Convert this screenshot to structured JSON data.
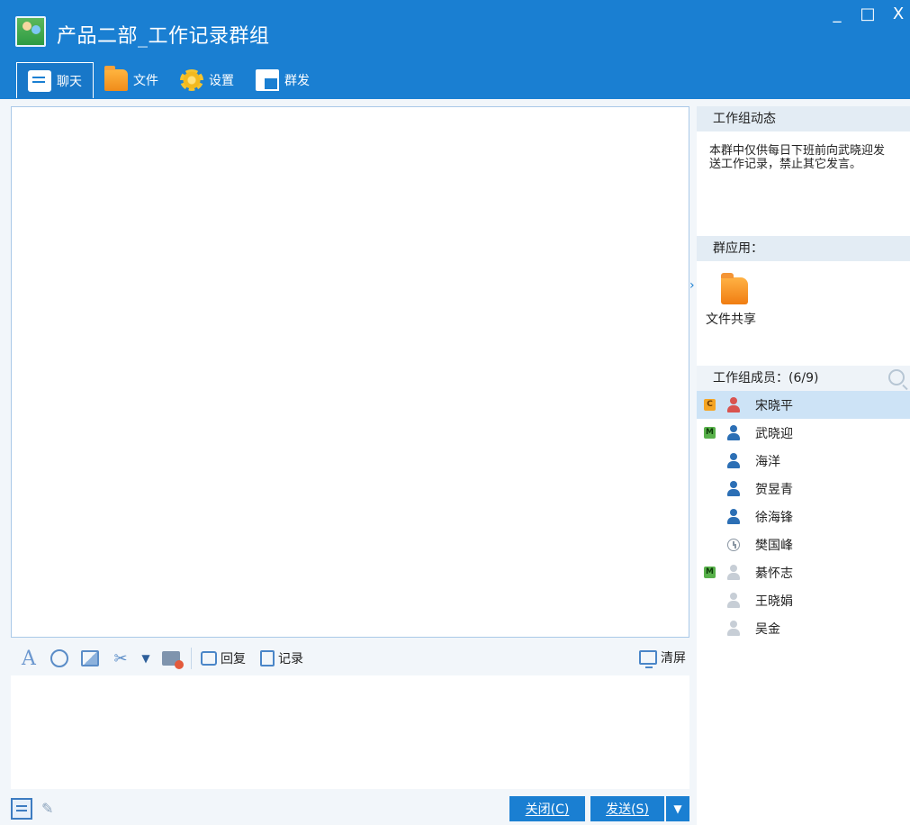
{
  "window": {
    "title": "产品二部_工作记录群组",
    "controls": {
      "minimize": "_",
      "maximize": "□",
      "close": "X"
    }
  },
  "tabs": [
    {
      "label": "聊天",
      "icon": "chat-icon",
      "active": true
    },
    {
      "label": "文件",
      "icon": "folder-icon",
      "active": false
    },
    {
      "label": "设置",
      "icon": "gear-icon",
      "active": false
    },
    {
      "label": "群发",
      "icon": "broadcast-icon",
      "active": false
    }
  ],
  "toolbar": {
    "reply_label": "回复",
    "record_label": "记录",
    "clear_label": "清屏"
  },
  "buttons": {
    "close_label": "关闭(C)",
    "send_label": "发送(S)"
  },
  "right_panel": {
    "notice_header": "工作组动态",
    "notice_line1": "本群中仅供每日下班前向武晓迎发",
    "notice_line2": "送工作记录，禁止其它发言。",
    "apps_header": "群应用：",
    "file_share_label": "文件共享",
    "members_header": "工作组成员：(6/9)",
    "members": [
      {
        "name": "宋晓平",
        "role": "C",
        "status": "online-red",
        "selected": true
      },
      {
        "name": "武晓迎",
        "role": "M",
        "status": "online"
      },
      {
        "name": "海洋",
        "role": "",
        "status": "online"
      },
      {
        "name": "贺昱青",
        "role": "",
        "status": "online"
      },
      {
        "name": "徐海锋",
        "role": "",
        "status": "online"
      },
      {
        "name": "樊国峰",
        "role": "",
        "status": "away"
      },
      {
        "name": "綦怀志",
        "role": "M",
        "status": "offline"
      },
      {
        "name": "王晓娟",
        "role": "",
        "status": "offline"
      },
      {
        "name": "吴金",
        "role": "",
        "status": "offline"
      }
    ]
  },
  "colors": {
    "titlebar": "#1a7fd2",
    "accent": "#1a7fd2",
    "selected_row": "#cde3f6"
  }
}
